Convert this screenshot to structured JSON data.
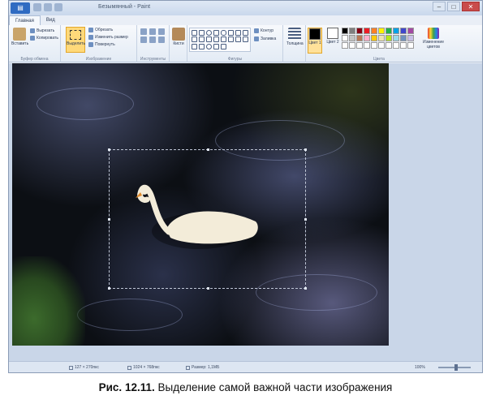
{
  "window": {
    "title": "Безымянный - Paint",
    "menu_button": "▤",
    "controls": {
      "minimize": "–",
      "maximize": "□",
      "close": "✕"
    }
  },
  "tabs": [
    {
      "label": "Главная",
      "active": true
    },
    {
      "label": "Вид",
      "active": false
    }
  ],
  "ribbon": {
    "clipboard": {
      "label": "Буфер обмена",
      "paste": "Вставить",
      "cut": "Вырезать",
      "copy": "Копировать"
    },
    "image": {
      "label": "Изображение",
      "select": "Выделить",
      "crop": "Обрезать",
      "resize": "Изменить размер",
      "rotate": "Повернуть"
    },
    "tools": {
      "label": "Инструменты"
    },
    "brushes": {
      "label": "Кисти"
    },
    "shapes": {
      "label": "Фигуры",
      "outline": "Контур",
      "fill": "Заливка"
    },
    "size": {
      "label": "Толщина"
    },
    "colors": {
      "label": "Цвета",
      "color1": "Цвет 1",
      "color2": "Цвет 2",
      "edit": "Изменение цветов",
      "color1_value": "#000000",
      "color2_value": "#ffffff",
      "palette": [
        "#000000",
        "#7f7f7f",
        "#880015",
        "#ed1c24",
        "#ff7f27",
        "#fff200",
        "#22b14c",
        "#00a2e8",
        "#3f48cc",
        "#a349a4",
        "#ffffff",
        "#c3c3c3",
        "#b97a57",
        "#ffaec9",
        "#ffc90e",
        "#efe4b0",
        "#b5e61d",
        "#99d9ea",
        "#7092be",
        "#c8bfe7",
        "#ffffff",
        "#ffffff",
        "#ffffff",
        "#ffffff",
        "#ffffff",
        "#ffffff",
        "#ffffff",
        "#ffffff",
        "#ffffff",
        "#ffffff"
      ]
    }
  },
  "status": {
    "cursor_pos": "127 × 270пкс",
    "selection_size": "1024 × 768пкс",
    "file_size": "Размер: 1,1МБ",
    "zoom": "100%"
  },
  "caption": {
    "figure": "Рис. 12.11.",
    "text": " Выделение самой важной части изображения"
  }
}
